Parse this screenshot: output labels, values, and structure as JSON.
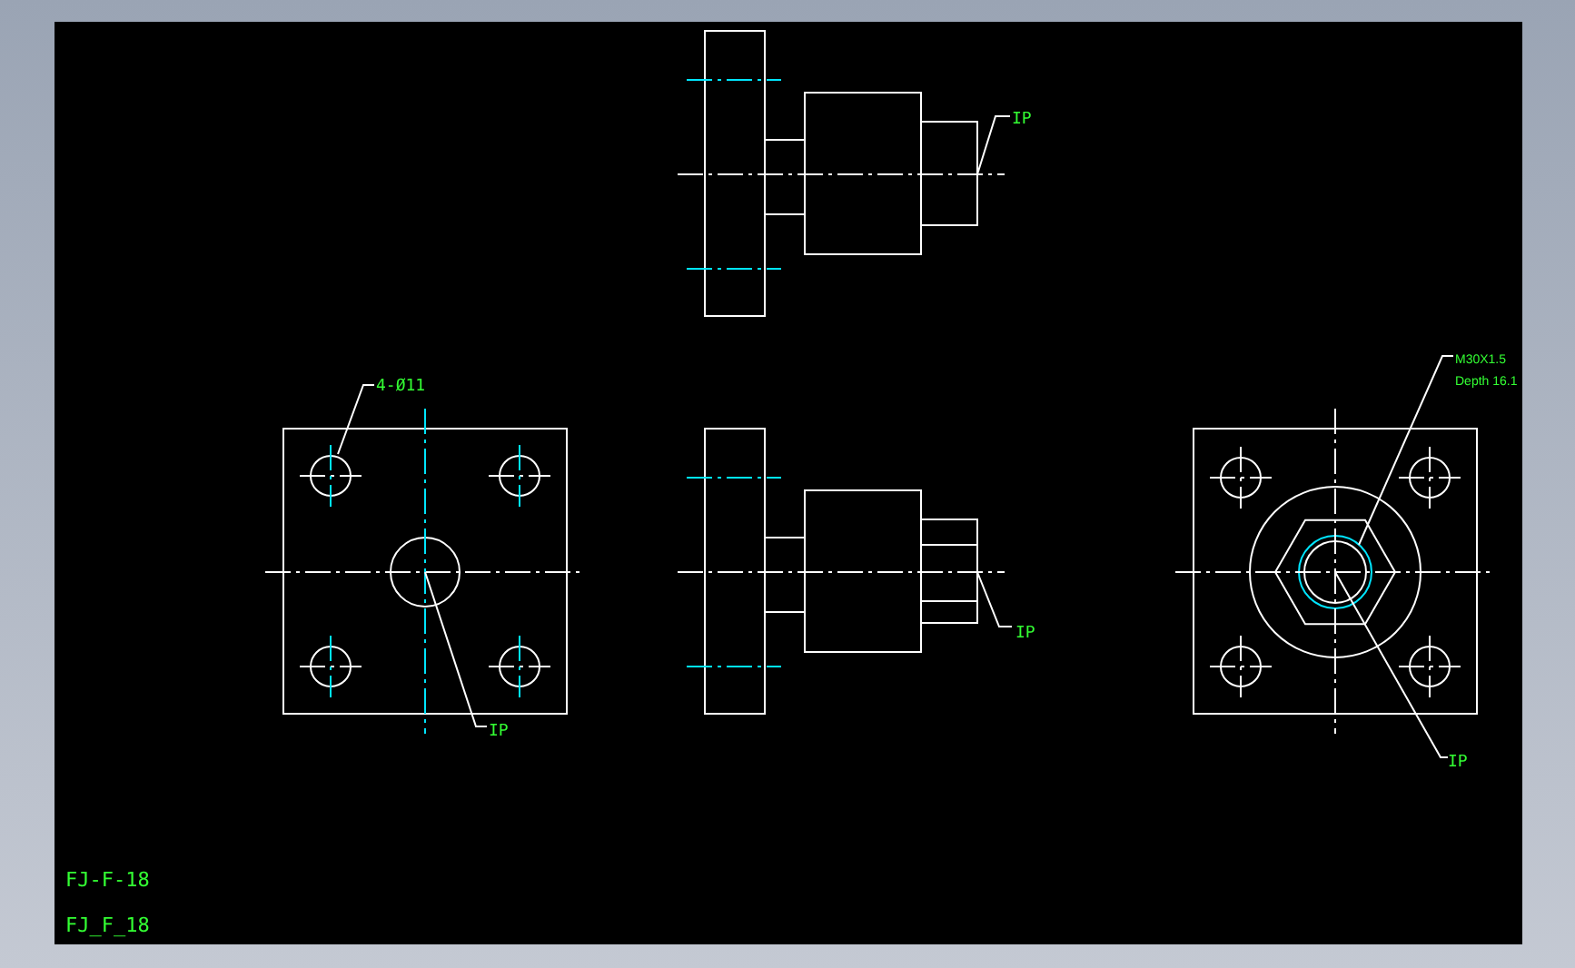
{
  "drawing": {
    "annotations": [
      {
        "text": "IP"
      },
      {
        "text": "4-Ø11"
      },
      {
        "text": "IP"
      },
      {
        "text": "IP"
      },
      {
        "text": "M30X1.5"
      },
      {
        "text": "Depth 16.1"
      },
      {
        "text": "IP"
      }
    ],
    "labels": [
      "FJ-F-18",
      "FJ_F_18"
    ]
  }
}
